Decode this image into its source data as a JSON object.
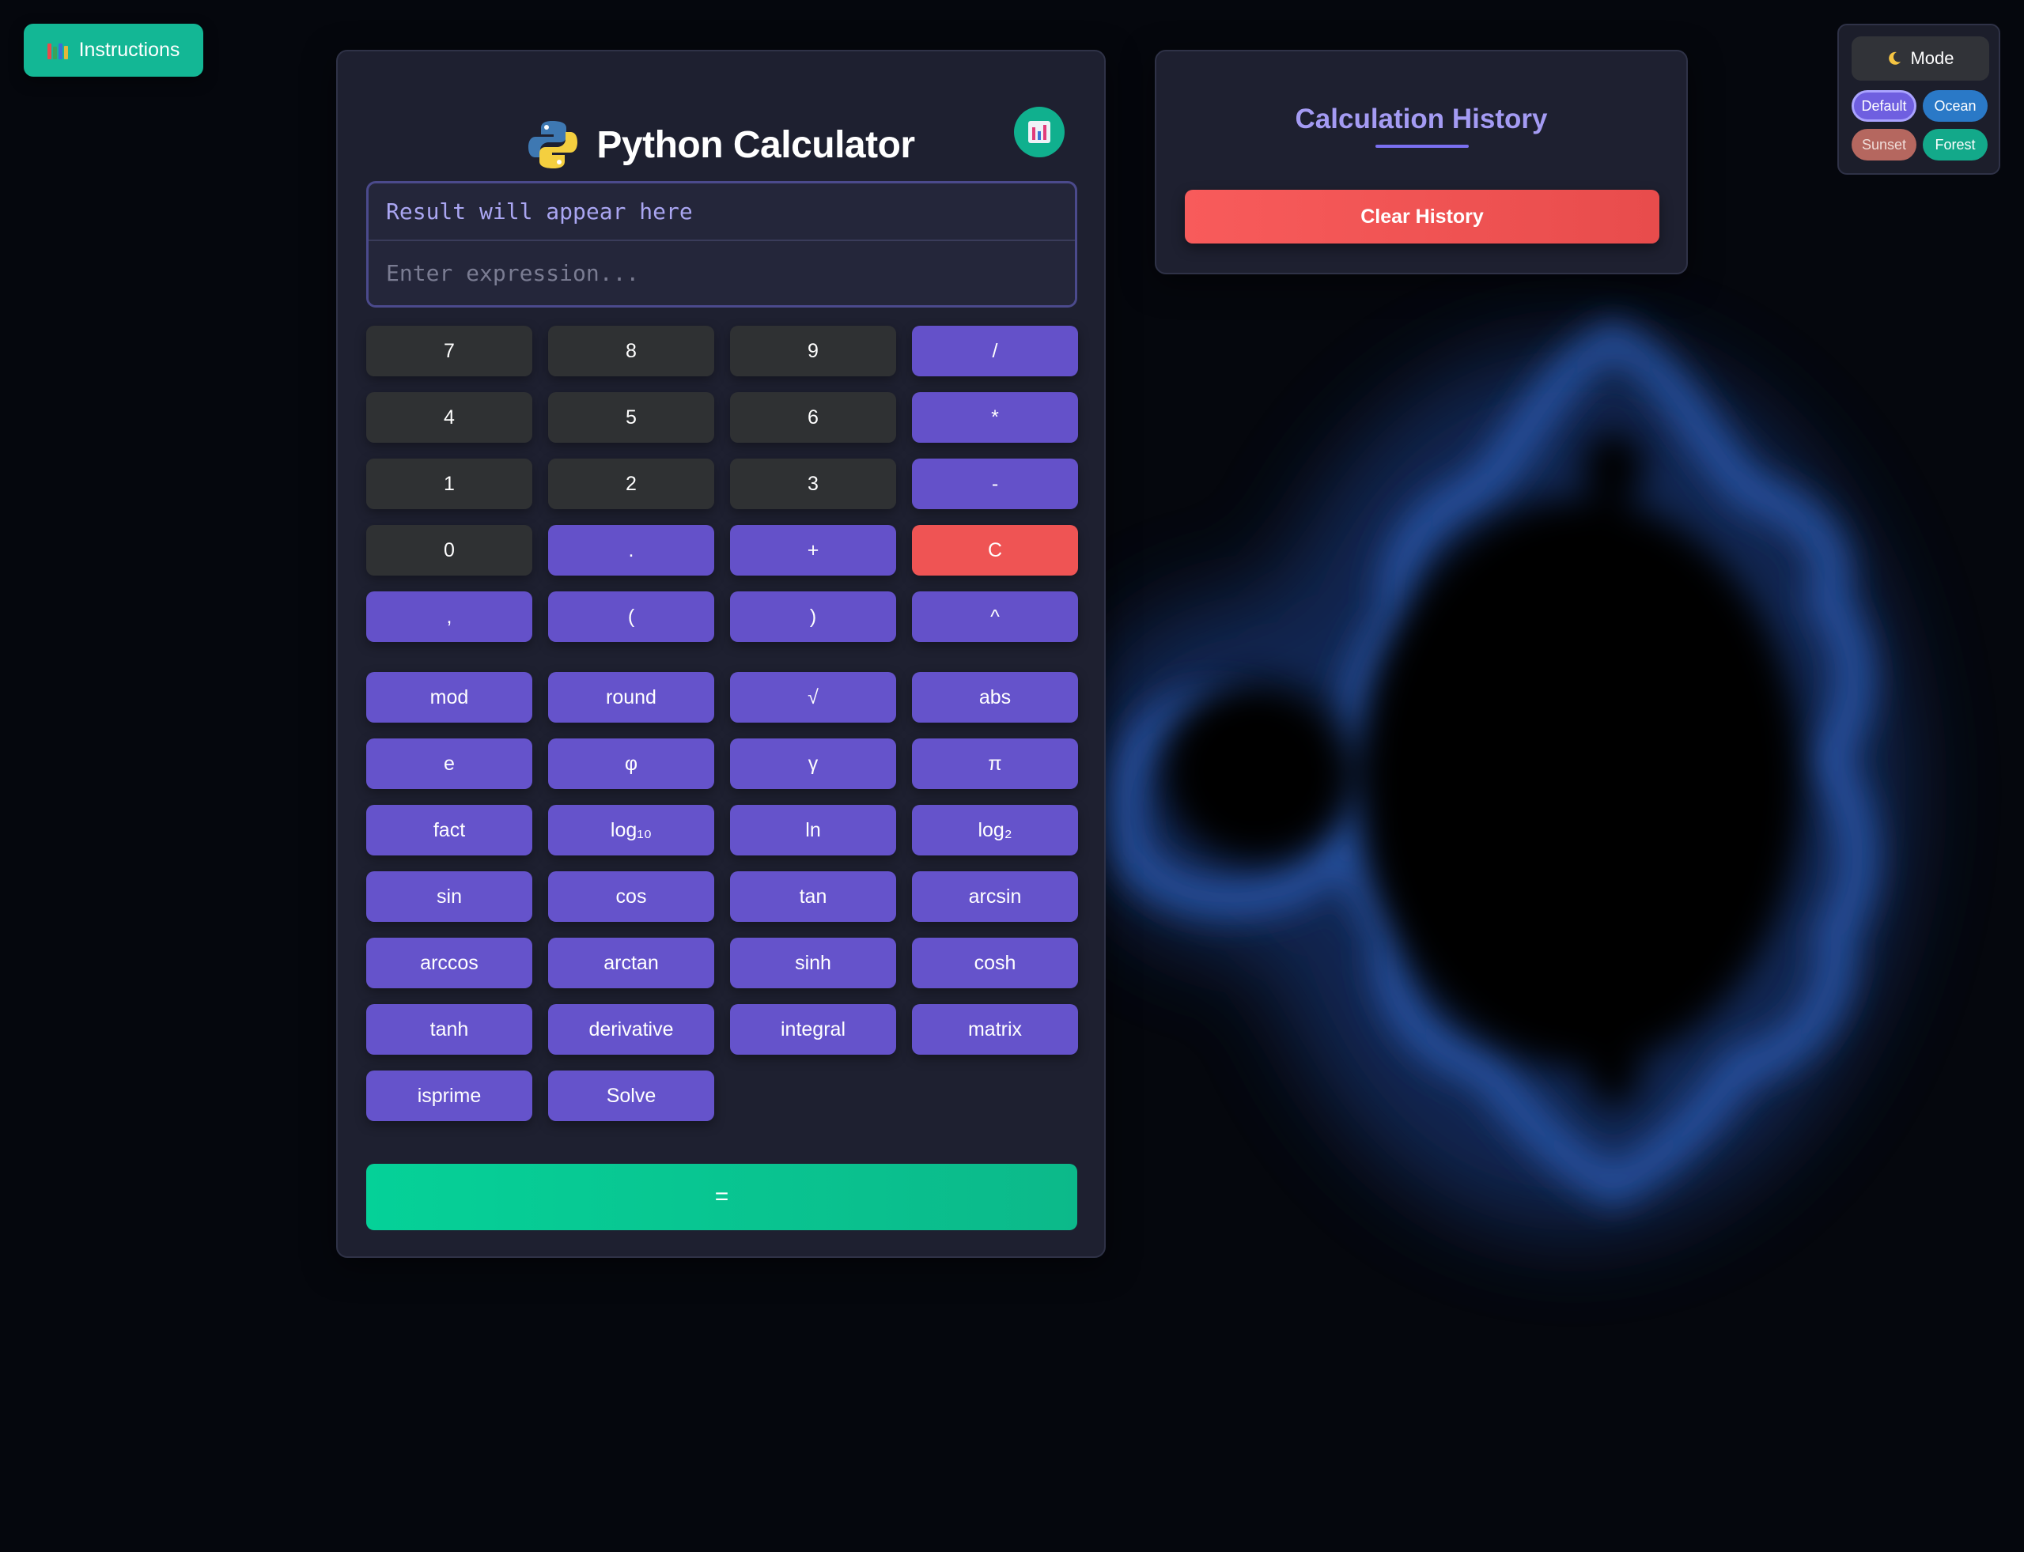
{
  "instructions": {
    "label": "Instructions",
    "icon": "books-icon"
  },
  "calculator": {
    "title": "Python Calculator",
    "logo": "python-logo-icon",
    "stats_icon": "bar-chart-icon",
    "result_placeholder": "Result will appear here",
    "expression_placeholder": "Enter expression...",
    "keys": [
      "7",
      "8",
      "9",
      "/",
      "4",
      "5",
      "6",
      "*",
      "1",
      "2",
      "3",
      "-",
      "0",
      ".",
      "+",
      "C",
      ",",
      "(",
      ")",
      "^"
    ],
    "functions": [
      "mod",
      "round",
      "√",
      "abs",
      "e",
      "φ",
      "γ",
      "π",
      "fact",
      "log₁₀",
      "ln",
      "log₂",
      "sin",
      "cos",
      "tan",
      "arcsin",
      "arccos",
      "arctan",
      "sinh",
      "cosh",
      "tanh",
      "derivative",
      "integral",
      "matrix",
      "isprime",
      "Solve"
    ],
    "equals_label": "="
  },
  "history": {
    "title": "Calculation History",
    "clear_label": "Clear History"
  },
  "mode_panel": {
    "mode_label": "Mode",
    "mode_icon": "moon-icon",
    "themes": [
      "Default",
      "Ocean",
      "Sunset",
      "Forest"
    ],
    "selected_theme": "Default"
  },
  "colors": {
    "accent": "#6553cb",
    "success": "#05d198",
    "danger": "#ef5454",
    "panel": "#1e2030"
  }
}
